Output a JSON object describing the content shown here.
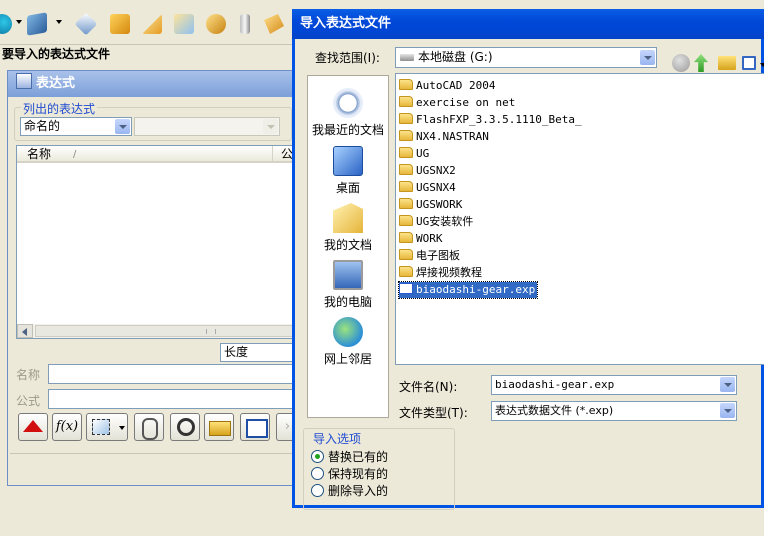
{
  "status_bar": {
    "prompt": "要导入的表达式文件"
  },
  "expressions_window": {
    "title": "表达式",
    "listed_group": {
      "legend": "列出的表达式",
      "filter_value": "命名的",
      "second_filter_value": ""
    },
    "table": {
      "columns": [
        "名称",
        "公"
      ]
    },
    "units_value": "长度",
    "name_label": "名称",
    "formula_label": "公式",
    "fx_button_label": "f(x)"
  },
  "import_dialog": {
    "title": "导入表达式文件",
    "look_in_label": "查找范围(I):",
    "look_in_value": "本地磁盘 (G:)",
    "places": [
      {
        "label": "我最近的文档",
        "icon": "recent-documents-icon"
      },
      {
        "label": "桌面",
        "icon": "desktop-icon"
      },
      {
        "label": "我的文档",
        "icon": "my-documents-icon"
      },
      {
        "label": "我的电脑",
        "icon": "my-computer-icon"
      },
      {
        "label": "网上邻居",
        "icon": "network-places-icon"
      }
    ],
    "files": [
      {
        "name": "AutoCAD 2004",
        "type": "folder"
      },
      {
        "name": "exercise on net",
        "type": "folder"
      },
      {
        "name": "FlashFXP_3.3.5.1110_Beta_",
        "type": "folder"
      },
      {
        "name": "NX4.NASTRAN",
        "type": "folder"
      },
      {
        "name": "UG",
        "type": "folder"
      },
      {
        "name": "UGSNX2",
        "type": "folder"
      },
      {
        "name": "UGSNX4",
        "type": "folder"
      },
      {
        "name": "UGSWORK",
        "type": "folder"
      },
      {
        "name": "UG安装软件",
        "type": "folder"
      },
      {
        "name": "WORK",
        "type": "folder"
      },
      {
        "name": "电子图板",
        "type": "folder"
      },
      {
        "name": "焊接视频教程",
        "type": "folder"
      },
      {
        "name": "biaodashi-gear.exp",
        "type": "file",
        "selected": true
      }
    ],
    "filename_label": "文件名(N):",
    "filename_value": "biaodashi-gear.exp",
    "filetype_label": "文件类型(T):",
    "filetype_value": "表达式数据文件 (*.exp)",
    "import_options": {
      "legend": "导入选项",
      "options": [
        {
          "label": "替换已有的",
          "checked": true
        },
        {
          "label": "保持现有的",
          "checked": false
        },
        {
          "label": "删除导入的",
          "checked": false
        }
      ]
    }
  },
  "colors": {
    "title_blue": "#0054e3",
    "selection_blue": "#316ac5",
    "group_legend_blue": "#1f4bd1",
    "window_face": "#ece9d8"
  }
}
